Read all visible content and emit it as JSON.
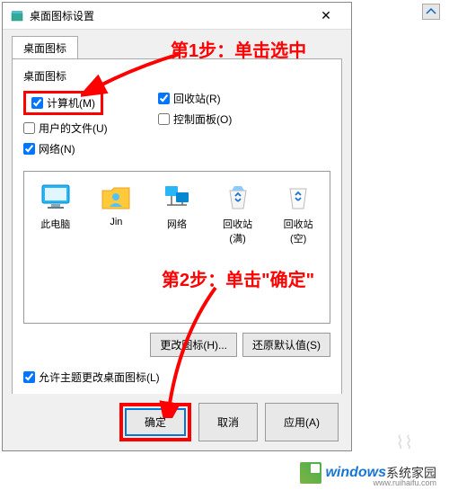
{
  "window": {
    "title": "桌面图标设置",
    "close": "✕"
  },
  "tabs": {
    "tab1": "桌面图标"
  },
  "section": {
    "label": "桌面图标"
  },
  "checkboxes": {
    "computer": "计算机(M)",
    "user_files": "用户的文件(U)",
    "network": "网络(N)",
    "recycle": "回收站(R)",
    "control": "控制面板(O)"
  },
  "icons": {
    "thispc": "此电脑",
    "jin": "Jin",
    "net": "网络",
    "recycle_full": "回收站(满)",
    "recycle_empty": "回收站(空)"
  },
  "buttons": {
    "change": "更改图标(H)...",
    "restore": "还原默认值(S)",
    "ok": "确定",
    "cancel": "取消",
    "apply": "应用(A)"
  },
  "theme_check": "允许主题更改桌面图标(L)",
  "annotations": {
    "step1": "第1步：单击选中",
    "step2": "第2步：单击\"确定\""
  },
  "watermark": {
    "brand1": "windows",
    "brand2": "系统家园",
    "url": "www.ruihaifu.com"
  }
}
